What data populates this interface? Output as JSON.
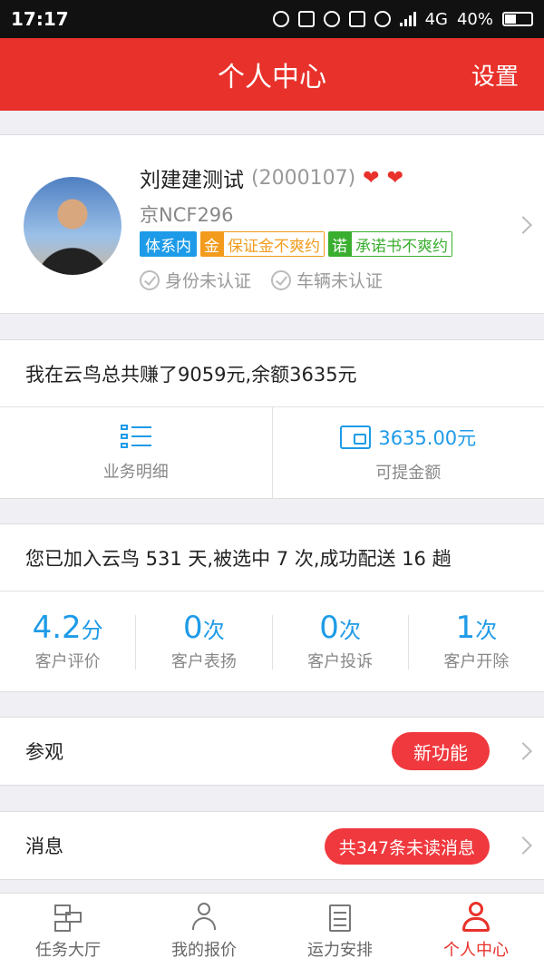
{
  "status_bar": {
    "time": "17:17",
    "network": "4G",
    "battery": "40%"
  },
  "header": {
    "title": "个人中心",
    "settings": "设置"
  },
  "profile": {
    "name": "刘建建测试",
    "user_id": "(2000107)",
    "plate": "京NCF296",
    "badges": {
      "system": "体系内",
      "deposit_key": "金",
      "deposit_value": "保证金不爽约",
      "promise_key": "诺",
      "promise_value": "承诺书不爽约"
    },
    "verify": {
      "identity": "身份未认证",
      "vehicle": "车辆未认证"
    }
  },
  "earnings": {
    "summary": "我在云鸟总共赚了9059元,余额3635元",
    "detail_label": "业务明细",
    "amount": "3635.00元",
    "withdraw_label": "可提金额"
  },
  "stats": {
    "summary": "您已加入云鸟 531 天,被选中 7 次,成功配送 16 趟",
    "items": [
      {
        "value": "4.2",
        "unit": "分",
        "label": "客户评价"
      },
      {
        "value": "0",
        "unit": "次",
        "label": "客户表扬"
      },
      {
        "value": "0",
        "unit": "次",
        "label": "客户投诉"
      },
      {
        "value": "1",
        "unit": "次",
        "label": "客户开除"
      }
    ]
  },
  "visit": {
    "label": "参观",
    "badge": "新功能"
  },
  "messages": {
    "label": "消息",
    "badge": "共347条未读消息"
  },
  "tabs": [
    {
      "label": "任务大厅",
      "icon": "task-hall-icon"
    },
    {
      "label": "我的报价",
      "icon": "my-quote-icon"
    },
    {
      "label": "运力安排",
      "icon": "capacity-plan-icon"
    },
    {
      "label": "个人中心",
      "icon": "profile-icon",
      "active": true
    }
  ],
  "colors": {
    "brand": "#e8312a",
    "accent": "#1e9be8"
  }
}
